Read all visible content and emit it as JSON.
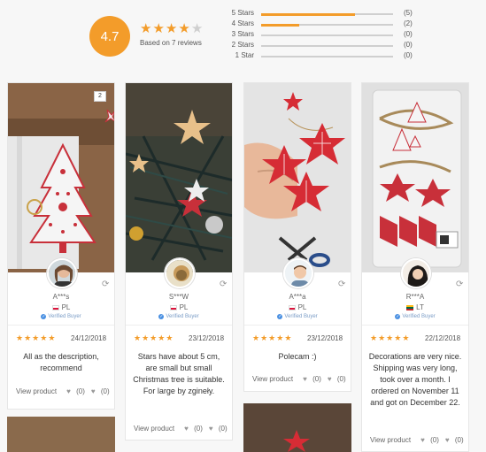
{
  "summary": {
    "rating": "4.7",
    "stars_filled": 4,
    "based_on": "Based on 7 reviews",
    "breakdown": [
      {
        "label": "5 Stars",
        "count": "(5)",
        "fill": 0.71
      },
      {
        "label": "4 Stars",
        "count": "(2)",
        "fill": 0.29
      },
      {
        "label": "3 Stars",
        "count": "(0)",
        "fill": 0
      },
      {
        "label": "2 Stars",
        "count": "(0)",
        "fill": 0
      },
      {
        "label": "1 Star",
        "count": "(0)",
        "fill": 0
      }
    ]
  },
  "colors": {
    "accent": "#f39c2a",
    "verified": "#4a90e2"
  },
  "reviews": [
    {
      "name": "A***s",
      "country": "PL",
      "verified": "Verified Buyer",
      "date": "24/12/2018",
      "text": "All as the description, recommend",
      "view": "View product",
      "likes": "(0)",
      "dislikes": "(0)",
      "photo_count": "2"
    },
    {
      "name": "S***W",
      "country": "PL",
      "verified": "Verified Buyer",
      "date": "23/12/2018",
      "text": "Stars have about 5 cm, are small but small Christmas tree is suitable. For large by zgineły.",
      "view": "View product",
      "likes": "(0)",
      "dislikes": "(0)"
    },
    {
      "name": "A***a",
      "country": "PL",
      "verified": "Verified Buyer",
      "date": "23/12/2018",
      "text": "Polecam :)",
      "view": "View product",
      "likes": "(0)",
      "dislikes": "(0)"
    },
    {
      "name": "R***A",
      "country": "LT",
      "verified": "Verified Buyer",
      "date": "22/12/2018",
      "text": "Decorations are very nice. Shipping was very long, took over a month. I ordered on November 11 and got on December 22.",
      "view": "View product",
      "likes": "(0)",
      "dislikes": "(0)"
    }
  ]
}
